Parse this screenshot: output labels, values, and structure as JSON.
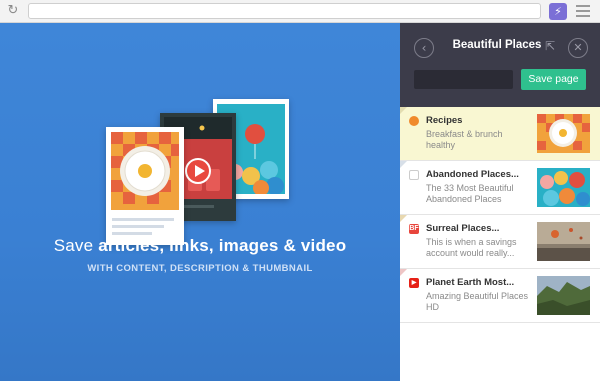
{
  "browser": {
    "reload_icon": "reload-icon",
    "extension_icon": "lightning-icon",
    "menu_icon": "hamburger-menu-icon"
  },
  "hero": {
    "title_prefix": "Save ",
    "title_bold": "articles, links, images & video",
    "subtitle": "WITH CONTENT, DESCRIPTION & THUMBNAIL"
  },
  "panel": {
    "title": "Beautiful Places",
    "save_label": "Save page",
    "input_value": "",
    "colors": {
      "header": "#3c3c4a",
      "save": "#2fc08e",
      "selected": "#f9f7d2"
    }
  },
  "items": [
    {
      "title": "Recipes",
      "desc": "Breakfast & brunch healthy",
      "favicon_glyph": "",
      "favicon_color": "#f08a2c",
      "thumb": "egg-plate"
    },
    {
      "title": "Abandoned Places...",
      "desc": "The 33 Most Beautiful Abandoned Places",
      "favicon_glyph": "",
      "favicon_color": "#ffffff",
      "thumb": "balloons"
    },
    {
      "title": "Surreal Places...",
      "desc": "This is when a savings account would really...",
      "favicon_glyph": "BF",
      "favicon_color": "#e8453c",
      "thumb": "hot-air-balloons"
    },
    {
      "title": "Planet Earth Most...",
      "desc": "Amazing Beautiful Places HD",
      "favicon_glyph": "▶",
      "favicon_color": "#e62117",
      "thumb": "mountain"
    }
  ]
}
